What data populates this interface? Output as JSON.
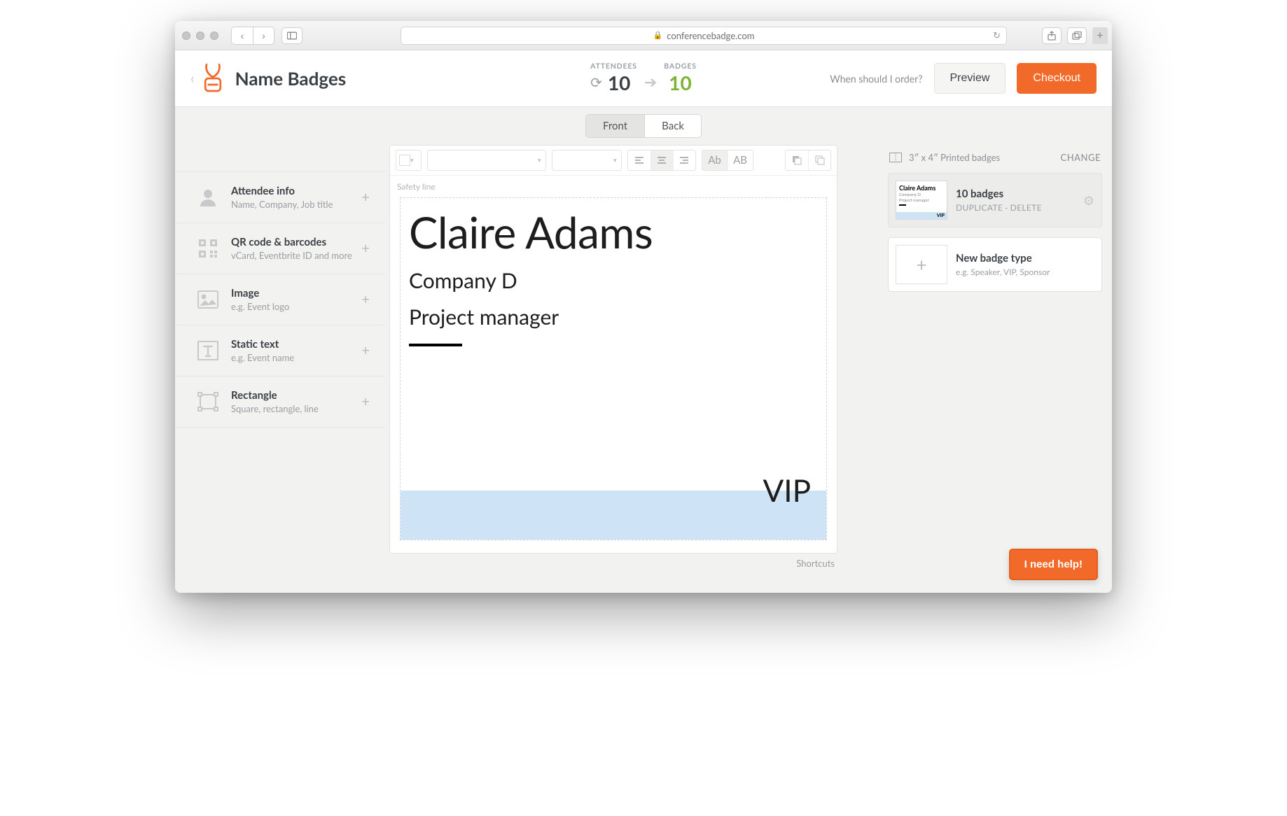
{
  "browser": {
    "url": "conferencebadge.com"
  },
  "header": {
    "title": "Name Badges",
    "attendees_label": "ATTENDEES",
    "attendees_count": "10",
    "badges_label": "BADGES",
    "badges_count": "10",
    "order_hint": "When should I order?",
    "preview_btn": "Preview",
    "checkout_btn": "Checkout"
  },
  "tabs": {
    "front": "Front",
    "back": "Back"
  },
  "tools": [
    {
      "title": "Attendee info",
      "sub": "Name, Company, Job title"
    },
    {
      "title": "QR code & barcodes",
      "sub": "vCard, Eventbrite ID and more"
    },
    {
      "title": "Image",
      "sub": "e.g. Event logo"
    },
    {
      "title": "Static text",
      "sub": "e.g. Event name"
    },
    {
      "title": "Rectangle",
      "sub": "Square, rectangle, line"
    }
  ],
  "canvas": {
    "safety": "Safety line",
    "name": "Claire Adams",
    "company": "Company D",
    "job": "Project manager",
    "vip": "VIP",
    "shortcuts": "Shortcuts"
  },
  "toolbar": {
    "case_mixed": "Ab",
    "case_upper": "AB"
  },
  "right": {
    "size": "3″ x 4″  Printed badges",
    "change": "CHANGE",
    "card_title": "10 badges",
    "duplicate": "DUPLICATE",
    "sep": "·",
    "delete": "DELETE",
    "thumb_name": "Claire Adams",
    "thumb_comp": "Company D",
    "thumb_job": "Project manager",
    "thumb_vip": "VIP",
    "new_title": "New badge type",
    "new_sub": "e.g. Speaker, VIP, Sponsor"
  },
  "help": "I need help!"
}
